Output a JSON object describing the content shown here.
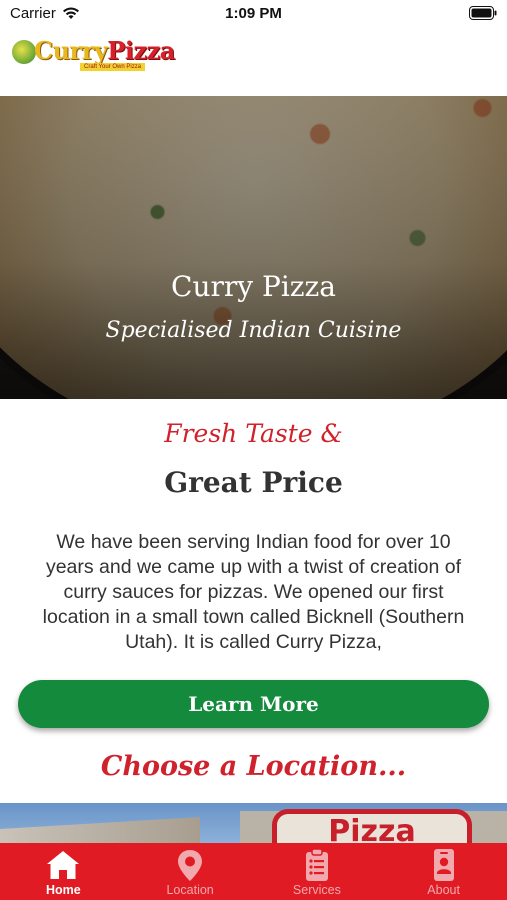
{
  "status_bar": {
    "carrier": "Carrier",
    "time": "1:09 PM"
  },
  "logo": {
    "word1": "Curry",
    "word2": "Pizza",
    "tagline": "Craft Your Own Pizza"
  },
  "hero": {
    "title": "Curry Pizza",
    "subtitle": "Specialised Indian Cuisine"
  },
  "intro": {
    "line1": "Fresh Taste &",
    "line2": "Great Price",
    "body": "We have been serving Indian food for over 10 years and we came up with a twist of creation of curry sauces for pizzas. We opened our first location in a small town called Bicknell (Southern Utah). It is called Curry Pizza,"
  },
  "learn_more_button": "Learn More",
  "locations": {
    "heading": "Choose a Location...",
    "sign_text": "Pizza"
  },
  "tab_bar": {
    "tabs": [
      {
        "label": "Home",
        "icon": "home-icon",
        "active": true
      },
      {
        "label": "Location",
        "icon": "location-pin-icon",
        "active": false
      },
      {
        "label": "Services",
        "icon": "clipboard-icon",
        "active": false
      },
      {
        "label": "About",
        "icon": "id-badge-icon",
        "active": false
      }
    ]
  },
  "colors": {
    "brand_red": "#e01b24",
    "accent_green": "#148a3c",
    "heading_red": "#d0222c"
  }
}
